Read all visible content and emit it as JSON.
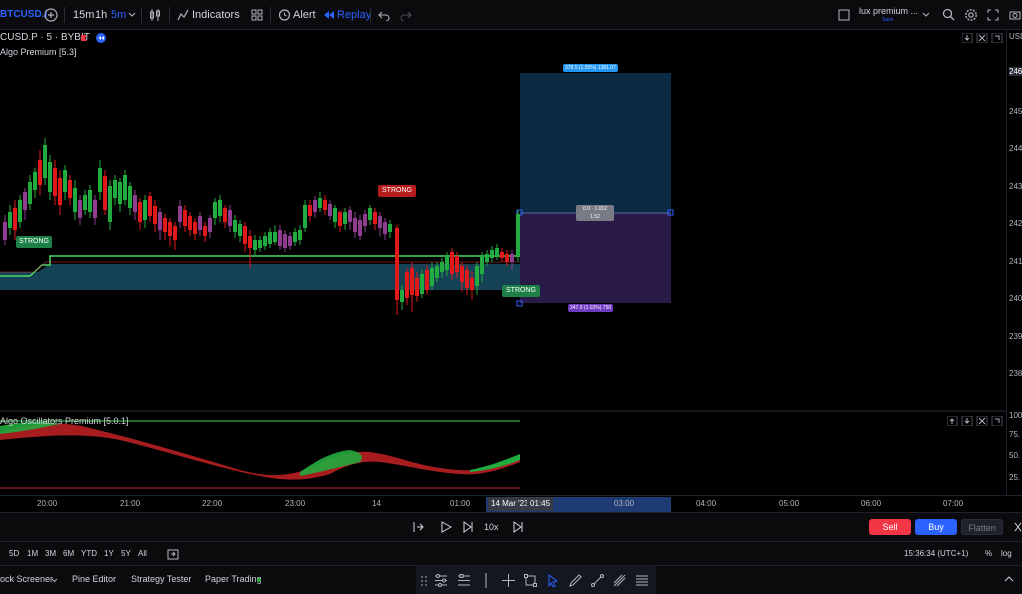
{
  "toolbar": {
    "symbol": "BTCUSD.I",
    "timeframes": [
      "15m",
      "1h",
      "5m"
    ],
    "indicators_label": "Indicators",
    "alert_label": "Alert",
    "replay_label": "Replay",
    "layout_name": "lux premium ...",
    "layout_status": "Save",
    "accent_color": "#2962ff"
  },
  "chart": {
    "symbol_legend": "CUSD.P · 5 · BYBIT",
    "indicator_legend": "Algo Premium [5.3]",
    "oscillator_legend": "Algo Oscillators Premium [5.0.1]",
    "signal_labels": [
      "STRONG",
      "STRONG",
      "STRONG"
    ],
    "target_label": "378.5 (1.55%) 1381.07",
    "entry_label": "0.0 · 1.012",
    "entry_sub": "1.52",
    "stop_label": "247.0 (1.02%) 750",
    "price_axis_unit": "USD",
    "price_ticks": [
      "246",
      "245",
      "244",
      "243",
      "242",
      "241",
      "240",
      "239",
      "238"
    ],
    "osc_ticks": [
      "100",
      "75.",
      "50.",
      "25."
    ],
    "time_ticks": [
      "20:00",
      "21:00",
      "22:00",
      "23:00",
      "14",
      "01:00",
      "03:00",
      "04:00",
      "05:00",
      "06:00",
      "07:00"
    ],
    "time_highlight": [
      "14 Mar '23",
      "01:45"
    ],
    "colors": {
      "up": "#22ab3e",
      "down": "#e0191b",
      "purple": "#8e3d91",
      "target_zone": "#0b2a44",
      "stop_zone": "#2a1a47",
      "trail_line": "#4cd964",
      "band": "#17485e"
    }
  },
  "replay": {
    "speed_label": "10x"
  },
  "trade": {
    "sell_label": "Sell",
    "buy_label": "Buy",
    "flatten_label": "Flatten",
    "sell_color": "#f23645",
    "buy_color": "#2962ff"
  },
  "ranges": [
    "5D",
    "1M",
    "3M",
    "6M",
    "YTD",
    "1Y",
    "5Y",
    "All"
  ],
  "status": {
    "clock": "15:36:34 (UTC+1)",
    "percent_label": "%",
    "log_label": "log"
  },
  "bottom_tabs": [
    "ock Screener",
    "Pine Editor",
    "Strategy Tester",
    "Paper Trading"
  ]
}
